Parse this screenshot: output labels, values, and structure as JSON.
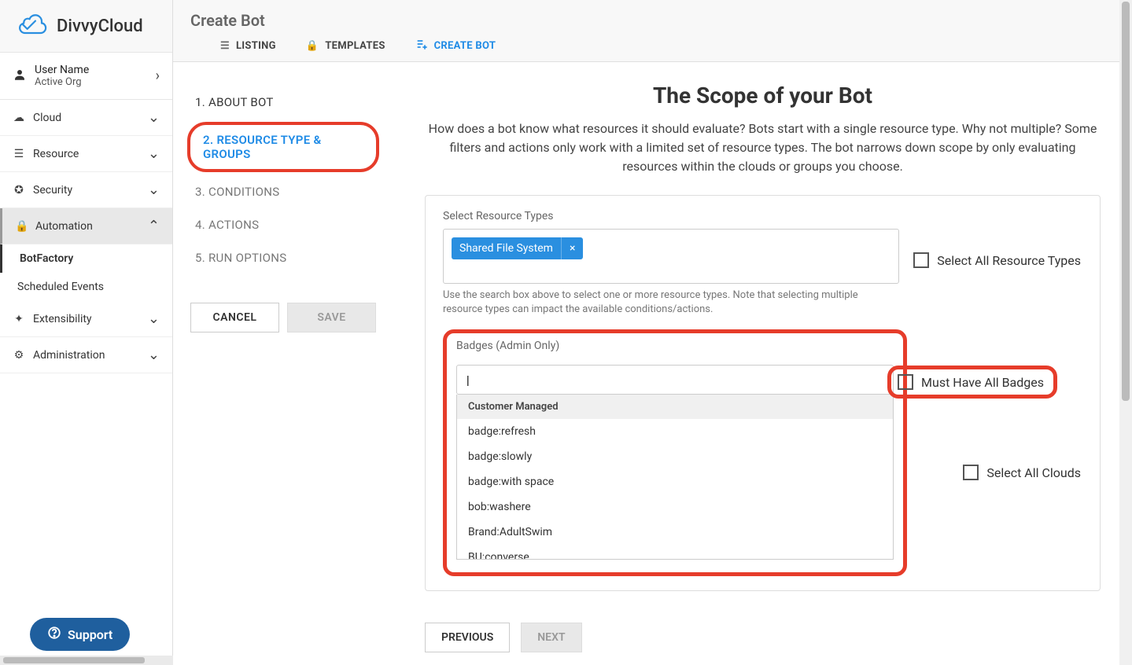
{
  "logo": "DivvyCloud",
  "user": {
    "name": "User Name",
    "org": "Active Org"
  },
  "nav": {
    "cloud": "Cloud",
    "resource": "Resource",
    "security": "Security",
    "automation": "Automation",
    "botfactory": "BotFactory",
    "scheduled_events": "Scheduled Events",
    "extensibility": "Extensibility",
    "administration": "Administration"
  },
  "support": "Support",
  "header": {
    "title": "Create Bot",
    "tabs": {
      "listing": "LISTING",
      "templates": "TEMPLATES",
      "create_bot": "CREATE BOT"
    }
  },
  "steps": {
    "s1": "1. ABOUT BOT",
    "s2": "2. RESOURCE TYPE & GROUPS",
    "s3": "3. CONDITIONS",
    "s4": "4. ACTIONS",
    "s5": "5. RUN OPTIONS",
    "cancel": "CANCEL",
    "save": "SAVE"
  },
  "form": {
    "title": "The Scope of your Bot",
    "desc": "How does a bot know what resources it should evaluate? Bots start with a single resource type. Why not multiple? Some filters and actions only work with a limited set of resource types. The bot narrows down scope by only evaluating resources within the clouds or groups you choose.",
    "resource_types_label": "Select Resource Types",
    "resource_tag": "Shared File System",
    "resource_help": "Use the search box above to select one or more resource types. Note that selecting multiple resource types can impact the available conditions/actions.",
    "badges_label": "Badges (Admin Only)",
    "cb_all_resources": "Select All Resource Types",
    "cb_all_badges": "Must Have All Badges",
    "cb_all_clouds": "Select All Clouds",
    "dropdown": {
      "group": "Customer Managed",
      "items": [
        "badge:refresh",
        "badge:slowly",
        "badge:with space",
        "bob:washere",
        "Brand:AdultSwim",
        "BU:converse"
      ]
    },
    "prev": "PREVIOUS",
    "next": "NEXT"
  }
}
